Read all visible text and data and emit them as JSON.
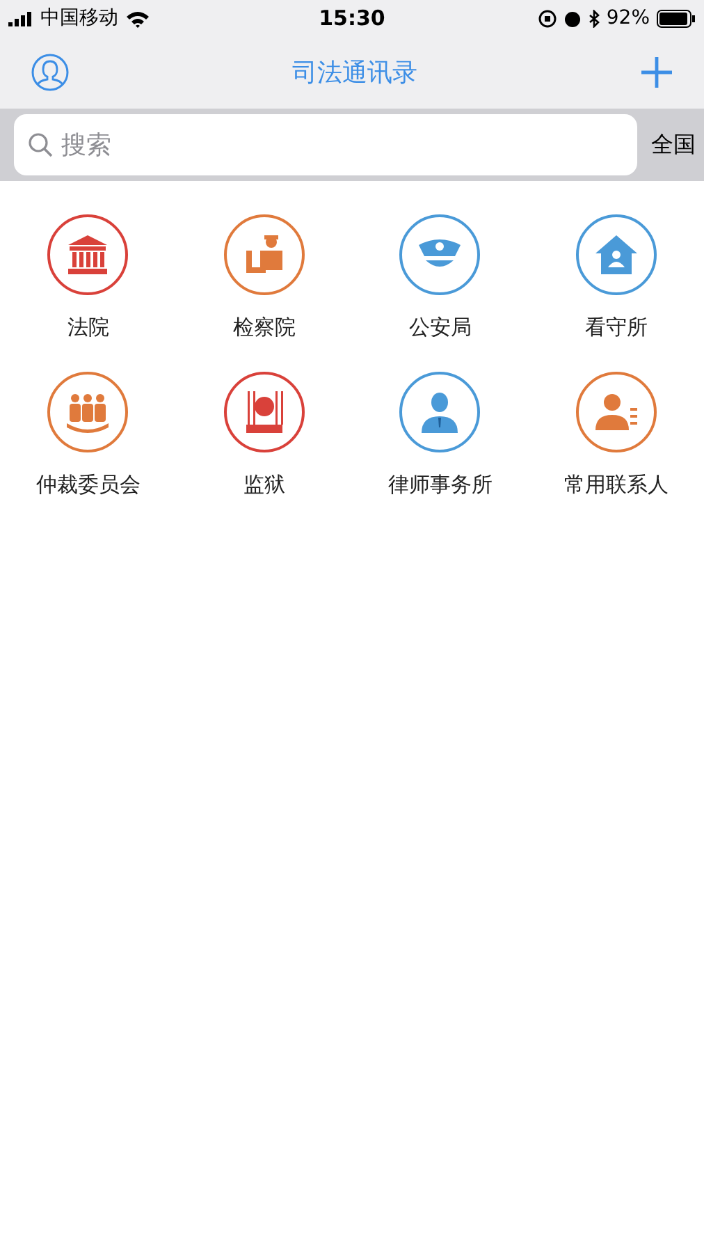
{
  "status_bar": {
    "carrier": "中国移动",
    "time": "15:30",
    "battery": "92%"
  },
  "nav": {
    "title": "司法通讯录"
  },
  "search": {
    "placeholder": "搜索",
    "region": "全国"
  },
  "categories": [
    {
      "label": "法院",
      "kind": "court",
      "color": "#d9413a"
    },
    {
      "label": "检察院",
      "kind": "prosecutor",
      "color": "#e07a3c"
    },
    {
      "label": "公安局",
      "kind": "police",
      "color": "#4a9ad8"
    },
    {
      "label": "看守所",
      "kind": "detention",
      "color": "#4a9ad8"
    },
    {
      "label": "仲裁委员会",
      "kind": "arbitration",
      "color": "#e07a3c"
    },
    {
      "label": "监狱",
      "kind": "prison",
      "color": "#d9413a"
    },
    {
      "label": "律师事务所",
      "kind": "lawyer",
      "color": "#4a9ad8"
    },
    {
      "label": "常用联系人",
      "kind": "contact",
      "color": "#e07a3c"
    }
  ]
}
